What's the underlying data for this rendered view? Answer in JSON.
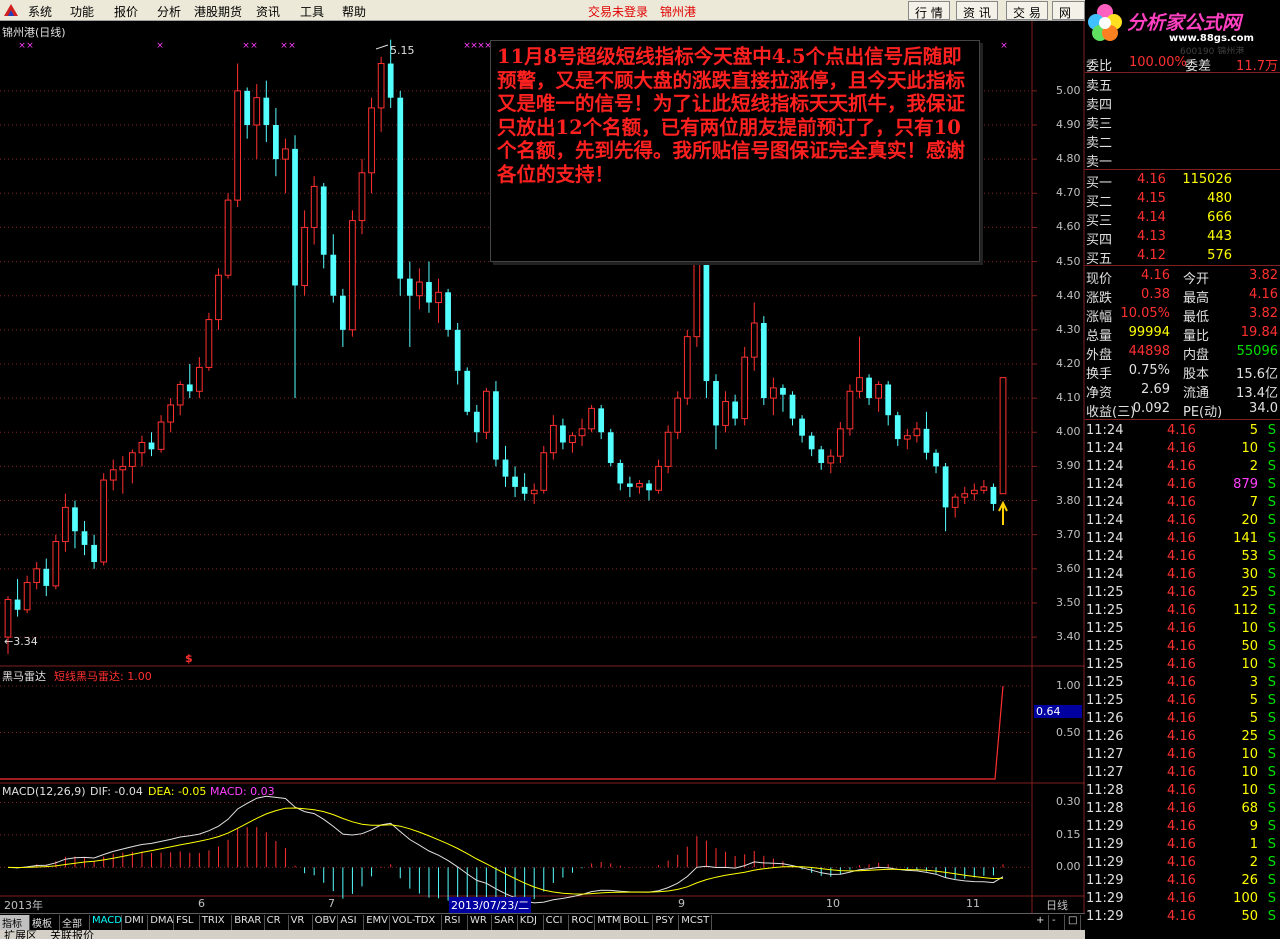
{
  "menu": {
    "items": [
      "系统",
      "功能",
      "报价",
      "分析",
      "港股期货",
      "资讯",
      "工具",
      "帮助"
    ],
    "status": "交易未登录",
    "stock": "锦州港",
    "right_tabs": [
      "行 情",
      "资 讯",
      "交 易",
      "网 上"
    ]
  },
  "brand": {
    "name": "分析家公式网",
    "url": "www.88gs.com",
    "code": "600190 锦州港"
  },
  "chart": {
    "title": "锦州港(日线)",
    "high_label": "5.15",
    "low_label": "←3.34",
    "price_ticks": [
      "5.00",
      "4.90",
      "4.80",
      "4.70",
      "4.60",
      "4.50",
      "4.40",
      "4.30",
      "4.20",
      "4.10",
      "4.00",
      "3.90",
      "3.80",
      "3.70",
      "3.60",
      "3.50",
      "3.40"
    ],
    "mark_dollar": "$",
    "ind1_name": "黑马雷达",
    "ind1_label": "短线黑马雷达: 1.00",
    "ind1_ticks": [
      "1.00",
      "0.50"
    ],
    "ind1_cursor": "0.64",
    "macd_name": "MACD(12,26,9)",
    "macd_dif": "DIF: -0.04",
    "macd_dea": "DEA: -0.05",
    "macd_val": "MACD: 0.03",
    "macd_ticks": [
      "0.30",
      "0.15",
      "0.00"
    ],
    "x_labels": [
      "2013年",
      "6",
      "7",
      "9",
      "10",
      "11"
    ],
    "x_cursor": "2013/07/23/二",
    "period": "日线"
  },
  "announcement": "11月8号超级短线指标今天盘中4.5个点出信号后随即预警，又是不顾大盘的涨跌直接拉涨停，且今天此指标又是唯一的信号！为了让此短线指标天天抓牛，我保证只放出12个名额，已有两位朋友提前预订了，只有10个名额，先到先得。我所贴信号图保证完全真实！感谢各位的支持！",
  "quote": {
    "weibi": {
      "label": "委比",
      "value": "100.00%",
      "label2": "委差",
      "value2": "11.7万"
    },
    "asks": [
      {
        "label": "卖五"
      },
      {
        "label": "卖四"
      },
      {
        "label": "卖三"
      },
      {
        "label": "卖二"
      },
      {
        "label": "卖一"
      }
    ],
    "bids": [
      {
        "label": "买一",
        "price": "4.16",
        "vol": "115026"
      },
      {
        "label": "买二",
        "price": "4.15",
        "vol": "480"
      },
      {
        "label": "买三",
        "price": "4.14",
        "vol": "666"
      },
      {
        "label": "买四",
        "price": "4.13",
        "vol": "443"
      },
      {
        "label": "买五",
        "price": "4.12",
        "vol": "576"
      }
    ],
    "stats": [
      {
        "l1": "现价",
        "v1": "4.16",
        "c1": "red",
        "l2": "今开",
        "v2": "3.82",
        "c2": "red"
      },
      {
        "l1": "涨跌",
        "v1": "0.38",
        "c1": "red",
        "l2": "最高",
        "v2": "4.16",
        "c2": "red"
      },
      {
        "l1": "涨幅",
        "v1": "10.05%",
        "c1": "red",
        "l2": "最低",
        "v2": "3.82",
        "c2": "red"
      },
      {
        "l1": "总量",
        "v1": "99994",
        "c1": "yel",
        "l2": "量比",
        "v2": "19.84",
        "c2": "red"
      },
      {
        "l1": "外盘",
        "v1": "44898",
        "c1": "red",
        "l2": "内盘",
        "v2": "55096",
        "c2": "grn"
      },
      {
        "l1": "换手",
        "v1": "0.75%",
        "c1": "wht",
        "l2": "股本",
        "v2": "15.6亿",
        "c2": "wht"
      },
      {
        "l1": "净资",
        "v1": "2.69",
        "c1": "wht",
        "l2": "流通",
        "v2": "13.4亿",
        "c2": "wht"
      },
      {
        "l1": "收益(三)",
        "v1": "0.092",
        "c1": "wht",
        "l2": "PE(动)",
        "v2": "34.0",
        "c2": "wht"
      }
    ],
    "ticks": [
      {
        "t": "11:24",
        "p": "4.16",
        "v": "5",
        "s": "S"
      },
      {
        "t": "11:24",
        "p": "4.16",
        "v": "10",
        "s": "S"
      },
      {
        "t": "11:24",
        "p": "4.16",
        "v": "2",
        "s": "S"
      },
      {
        "t": "11:24",
        "p": "4.16",
        "v": "879",
        "s": "S"
      },
      {
        "t": "11:24",
        "p": "4.16",
        "v": "7",
        "s": "S"
      },
      {
        "t": "11:24",
        "p": "4.16",
        "v": "20",
        "s": "S"
      },
      {
        "t": "11:24",
        "p": "4.16",
        "v": "141",
        "s": "S"
      },
      {
        "t": "11:24",
        "p": "4.16",
        "v": "53",
        "s": "S"
      },
      {
        "t": "11:24",
        "p": "4.16",
        "v": "30",
        "s": "S"
      },
      {
        "t": "11:25",
        "p": "4.16",
        "v": "25",
        "s": "S"
      },
      {
        "t": "11:25",
        "p": "4.16",
        "v": "112",
        "s": "S"
      },
      {
        "t": "11:25",
        "p": "4.16",
        "v": "10",
        "s": "S"
      },
      {
        "t": "11:25",
        "p": "4.16",
        "v": "50",
        "s": "S"
      },
      {
        "t": "11:25",
        "p": "4.16",
        "v": "10",
        "s": "S"
      },
      {
        "t": "11:25",
        "p": "4.16",
        "v": "3",
        "s": "S"
      },
      {
        "t": "11:25",
        "p": "4.16",
        "v": "5",
        "s": "S"
      },
      {
        "t": "11:26",
        "p": "4.16",
        "v": "5",
        "s": "S"
      },
      {
        "t": "11:26",
        "p": "4.16",
        "v": "25",
        "s": "S"
      },
      {
        "t": "11:27",
        "p": "4.16",
        "v": "10",
        "s": "S"
      },
      {
        "t": "11:27",
        "p": "4.16",
        "v": "10",
        "s": "S"
      },
      {
        "t": "11:28",
        "p": "4.16",
        "v": "10",
        "s": "S"
      },
      {
        "t": "11:28",
        "p": "4.16",
        "v": "68",
        "s": "S"
      },
      {
        "t": "11:29",
        "p": "4.16",
        "v": "9",
        "s": "S"
      },
      {
        "t": "11:29",
        "p": "4.16",
        "v": "1",
        "s": "S"
      },
      {
        "t": "11:29",
        "p": "4.16",
        "v": "2",
        "s": "S"
      },
      {
        "t": "11:29",
        "p": "4.16",
        "v": "26",
        "s": "S"
      },
      {
        "t": "11:29",
        "p": "4.16",
        "v": "100",
        "s": "S"
      },
      {
        "t": "11:29",
        "p": "4.16",
        "v": "50",
        "s": "S"
      }
    ]
  },
  "tabs": [
    "指标",
    "模板",
    "全部",
    "MACD",
    "DMI",
    "DMA",
    "FSL",
    "TRIX",
    "BRAR",
    "CR",
    "VR",
    "OBV",
    "ASI",
    "EMV",
    "VOL-TDX",
    "RSI",
    "WR",
    "SAR",
    "KDJ",
    "CCI",
    "ROC",
    "MTM",
    "BOLL",
    "PSY",
    "MCST"
  ],
  "bottom": [
    "扩展区",
    "关联报价"
  ],
  "colors": {
    "up": "#ff3030",
    "down": "#54ffff",
    "grid": "#802020",
    "text": "#c0c0c0",
    "accent": "#ff3030"
  },
  "chart_data": {
    "type": "candlestick",
    "title": "锦州港(日线)",
    "ylim": [
      3.33,
      5.19
    ],
    "high": 5.15,
    "low": 3.34,
    "candles": [
      [
        3.4,
        3.52,
        3.35,
        3.51
      ],
      [
        3.51,
        3.57,
        3.46,
        3.48
      ],
      [
        3.48,
        3.58,
        3.47,
        3.56
      ],
      [
        3.56,
        3.62,
        3.54,
        3.6
      ],
      [
        3.6,
        3.63,
        3.52,
        3.55
      ],
      [
        3.55,
        3.7,
        3.54,
        3.68
      ],
      [
        3.68,
        3.82,
        3.65,
        3.78
      ],
      [
        3.78,
        3.8,
        3.66,
        3.71
      ],
      [
        3.71,
        3.74,
        3.64,
        3.67
      ],
      [
        3.67,
        3.7,
        3.6,
        3.62
      ],
      [
        3.62,
        3.88,
        3.61,
        3.86
      ],
      [
        3.86,
        3.92,
        3.83,
        3.89
      ],
      [
        3.89,
        3.93,
        3.82,
        3.9
      ],
      [
        3.9,
        3.95,
        3.85,
        3.94
      ],
      [
        3.94,
        3.99,
        3.9,
        3.97
      ],
      [
        3.97,
        4.0,
        3.93,
        3.95
      ],
      [
        3.95,
        4.05,
        3.94,
        4.03
      ],
      [
        4.03,
        4.1,
        4.0,
        4.08
      ],
      [
        4.08,
        4.15,
        4.05,
        4.14
      ],
      [
        4.14,
        4.2,
        4.1,
        4.12
      ],
      [
        4.12,
        4.22,
        4.1,
        4.19
      ],
      [
        4.19,
        4.35,
        4.18,
        4.33
      ],
      [
        4.33,
        4.48,
        4.3,
        4.46
      ],
      [
        4.46,
        4.7,
        4.45,
        4.68
      ],
      [
        4.68,
        5.08,
        4.66,
        5.0
      ],
      [
        5.0,
        5.01,
        4.86,
        4.9
      ],
      [
        4.9,
        5.02,
        4.8,
        4.98
      ],
      [
        4.98,
        5.03,
        4.85,
        4.9
      ],
      [
        4.9,
        4.95,
        4.75,
        4.8
      ],
      [
        4.8,
        4.86,
        4.7,
        4.83
      ],
      [
        4.83,
        4.87,
        4.1,
        4.43
      ],
      [
        4.43,
        4.65,
        4.4,
        4.6
      ],
      [
        4.6,
        4.75,
        4.55,
        4.72
      ],
      [
        4.72,
        4.73,
        4.48,
        4.52
      ],
      [
        4.52,
        4.58,
        4.38,
        4.4
      ],
      [
        4.4,
        4.42,
        4.25,
        4.3
      ],
      [
        4.3,
        4.65,
        4.28,
        4.62
      ],
      [
        4.62,
        4.8,
        4.58,
        4.76
      ],
      [
        4.76,
        4.98,
        4.7,
        4.95
      ],
      [
        4.95,
        5.1,
        4.88,
        5.08
      ],
      [
        5.08,
        5.15,
        4.95,
        4.98
      ],
      [
        4.98,
        5.0,
        4.4,
        4.45
      ],
      [
        4.45,
        4.5,
        4.25,
        4.4
      ],
      [
        4.4,
        4.48,
        4.36,
        4.44
      ],
      [
        4.44,
        4.5,
        4.35,
        4.38
      ],
      [
        4.38,
        4.45,
        4.32,
        4.41
      ],
      [
        4.41,
        4.42,
        4.28,
        4.3
      ],
      [
        4.3,
        4.32,
        4.14,
        4.18
      ],
      [
        4.18,
        4.19,
        4.05,
        4.06
      ],
      [
        4.06,
        4.08,
        3.97,
        4.0
      ],
      [
        4.0,
        4.13,
        3.98,
        4.12
      ],
      [
        4.12,
        4.15,
        3.9,
        3.92
      ],
      [
        3.92,
        3.96,
        3.84,
        3.87
      ],
      [
        3.87,
        3.9,
        3.81,
        3.84
      ],
      [
        3.84,
        3.88,
        3.8,
        3.82
      ],
      [
        3.82,
        3.85,
        3.79,
        3.83
      ],
      [
        3.83,
        3.96,
        3.82,
        3.94
      ],
      [
        3.94,
        4.05,
        3.92,
        4.02
      ],
      [
        4.02,
        4.04,
        3.95,
        3.97
      ],
      [
        3.97,
        4.0,
        3.94,
        3.99
      ],
      [
        3.99,
        4.04,
        3.96,
        4.01
      ],
      [
        4.01,
        4.08,
        4.0,
        4.07
      ],
      [
        4.07,
        4.08,
        3.98,
        4.0
      ],
      [
        4.0,
        4.01,
        3.9,
        3.91
      ],
      [
        3.91,
        3.92,
        3.83,
        3.85
      ],
      [
        3.85,
        3.87,
        3.81,
        3.84
      ],
      [
        3.84,
        3.86,
        3.82,
        3.85
      ],
      [
        3.85,
        3.86,
        3.8,
        3.83
      ],
      [
        3.83,
        3.92,
        3.82,
        3.9
      ],
      [
        3.9,
        4.02,
        3.88,
        4.0
      ],
      [
        4.0,
        4.12,
        3.98,
        4.1
      ],
      [
        4.1,
        4.3,
        4.08,
        4.28
      ],
      [
        4.28,
        4.6,
        4.25,
        4.5
      ],
      [
        4.5,
        4.52,
        4.1,
        4.15
      ],
      [
        4.15,
        4.17,
        3.95,
        4.02
      ],
      [
        4.02,
        4.12,
        4.0,
        4.09
      ],
      [
        4.09,
        4.11,
        4.02,
        4.04
      ],
      [
        4.04,
        4.25,
        4.02,
        4.22
      ],
      [
        4.22,
        4.38,
        4.18,
        4.32
      ],
      [
        4.32,
        4.34,
        4.08,
        4.1
      ],
      [
        4.1,
        4.16,
        4.05,
        4.13
      ],
      [
        4.13,
        4.14,
        4.06,
        4.11
      ],
      [
        4.11,
        4.12,
        4.02,
        4.04
      ],
      [
        4.04,
        4.05,
        3.97,
        3.99
      ],
      [
        3.99,
        4.0,
        3.93,
        3.95
      ],
      [
        3.95,
        3.96,
        3.89,
        3.91
      ],
      [
        3.91,
        3.95,
        3.88,
        3.93
      ],
      [
        3.93,
        4.03,
        3.91,
        4.01
      ],
      [
        4.01,
        4.14,
        3.99,
        4.12
      ],
      [
        4.12,
        4.28,
        4.1,
        4.16
      ],
      [
        4.16,
        4.17,
        4.08,
        4.1
      ],
      [
        4.1,
        4.15,
        4.06,
        4.14
      ],
      [
        4.14,
        4.15,
        4.02,
        4.05
      ],
      [
        4.05,
        4.06,
        3.96,
        3.98
      ],
      [
        3.98,
        4.01,
        3.95,
        3.99
      ],
      [
        3.99,
        4.03,
        3.97,
        4.01
      ],
      [
        4.01,
        4.06,
        3.92,
        3.94
      ],
      [
        3.94,
        3.95,
        3.88,
        3.9
      ],
      [
        3.9,
        3.91,
        3.71,
        3.78
      ],
      [
        3.78,
        3.82,
        3.75,
        3.81
      ],
      [
        3.81,
        3.84,
        3.79,
        3.82
      ],
      [
        3.82,
        3.85,
        3.8,
        3.83
      ],
      [
        3.83,
        3.86,
        3.82,
        3.84
      ],
      [
        3.84,
        3.85,
        3.77,
        3.79
      ],
      [
        3.82,
        4.16,
        3.82,
        4.16
      ]
    ],
    "ind1": {
      "name": "短线黑马雷达",
      "value": 1.0
    },
    "macd": {
      "dif": -0.04,
      "dea": -0.05,
      "macd": 0.03,
      "ylim": [
        -0.1,
        0.33
      ]
    }
  }
}
